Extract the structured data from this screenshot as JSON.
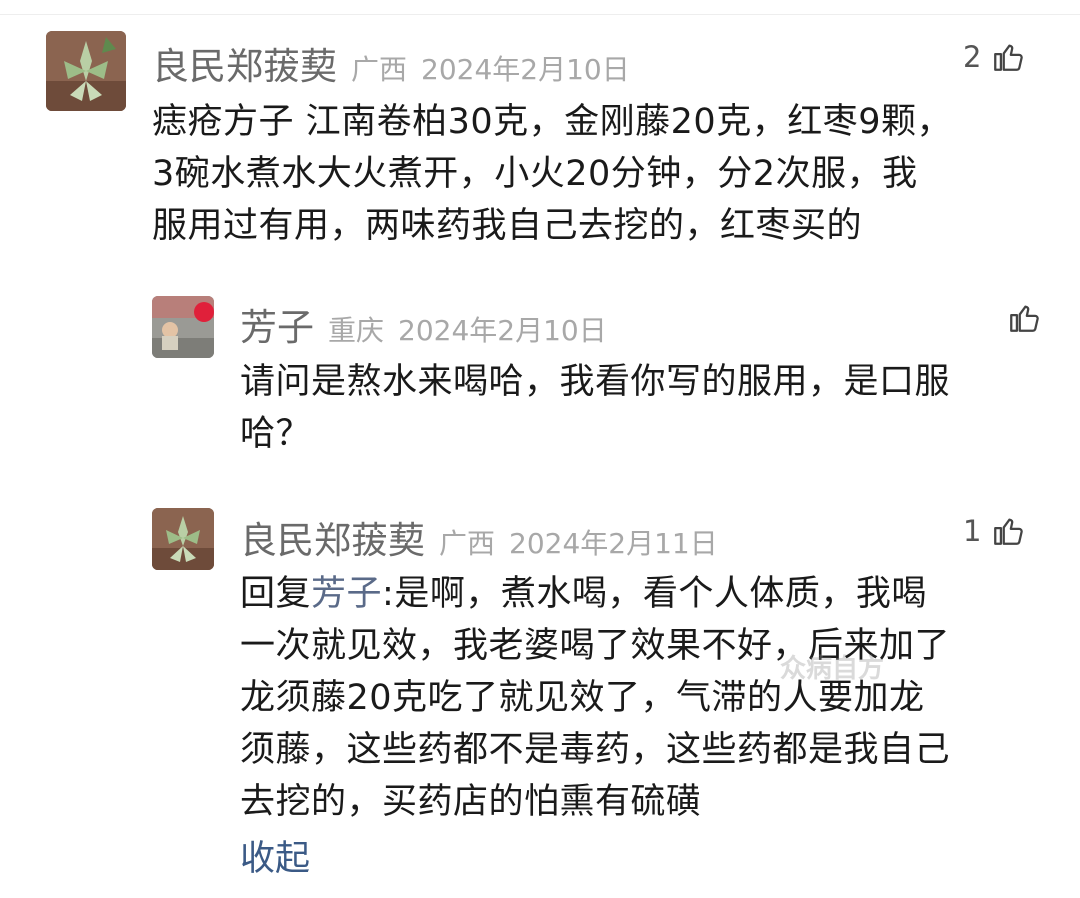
{
  "comments": [
    {
      "author": "良民郑菝葜",
      "region": "广西",
      "date": "2024年2月10日",
      "likes": "2",
      "lines": [
        "痣疮方子 江南卷柏30克，金刚藤20克，红枣9颗，",
        "3碗水煮水大火煮开，小火20分钟，分2次服，我",
        "服用过有用，两味药我自己去挖的，红枣买的"
      ]
    },
    {
      "author": "芳子",
      "region": "重庆",
      "date": "2024年2月10日",
      "likes": "",
      "lines": [
        "请问是熬水来喝哈，我看你写的服用，是口服",
        "哈？"
      ]
    },
    {
      "author": "良民郑菝葜",
      "region": "广西",
      "date": "2024年2月11日",
      "likes": "1",
      "reply_prefix": "回复",
      "reply_to": "芳子",
      "reply_first": ":是啊，煮水喝，看个人体质，我喝",
      "lines": [
        "一次就见效，我老婆喝了效果不好，后来加了",
        "龙须藤20克吃了就见效了，气滞的人要加龙",
        "须藤，这些药都不是毒药，这些药都是我自己",
        "去挖的，买药店的怕熏有硫磺"
      ]
    }
  ],
  "collapse_label": "收起",
  "watermark": "众病自方",
  "icons": {
    "like": "thumbs-up-icon"
  },
  "colors": {
    "author": "#6a6a6a",
    "meta": "#a8a8a8",
    "link": "#3b5a86"
  }
}
